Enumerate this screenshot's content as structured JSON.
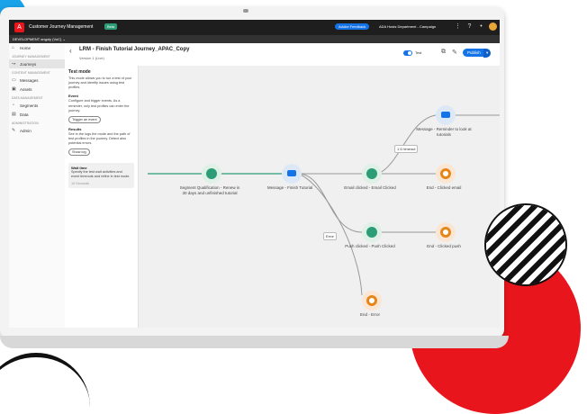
{
  "colors": {
    "accent": "#1473e6",
    "brand": "#e8151c",
    "start_node": "#2d9d78",
    "message_node": "#1473e6",
    "end_node": "#e68619"
  },
  "topbar": {
    "logo_glyph": "A",
    "app_name": "Customer Journey Management",
    "beta_badge": "Beta",
    "feedback_button": "Adobe Feedback",
    "org_name": "ADA Hosts Department - Campaign",
    "icons": [
      "apps-icon",
      "help-icon",
      "bell-icon",
      "settings-icon"
    ]
  },
  "sandbox": {
    "label": "DEVELOPMENT  angoly (VoC) ⌄"
  },
  "sidebar": {
    "home": "Home",
    "sec_journey": "JOURNEY MANAGEMENT",
    "journeys": "Journeys",
    "sec_content": "CONTENT MANAGEMENT",
    "messages": "Messages",
    "assets": "Assets",
    "sec_data": "DATA MANAGEMENT",
    "segments": "Segments",
    "data": "Data",
    "sec_admin": "ADMINISTRATION",
    "admin": "Admin"
  },
  "header": {
    "title": "LRM - Finish Tutorial Journey_APAC_Copy",
    "version": "Version 1 (Live)",
    "test_label": "Test",
    "publish": "Publish"
  },
  "test_panel": {
    "title": "Test mode",
    "desc": "This mode allows you to run a test of your journey and identify issues using test profiles.",
    "event_heading": "Event",
    "event_desc": "Configure and trigger events. As a reminder, only test profiles can enter the journey.",
    "trigger_button": "Trigger an event",
    "results_heading": "Results",
    "results_desc": "See in the logs the mode and the path of test profiles in the journey. Detect also potential errors.",
    "show_log_button": "Show log",
    "wait_title": "Wait time",
    "wait_desc": "Specify the test wait activities and event timeouts and refine in test mode.",
    "wait_value": "10",
    "wait_unit": "Seconds"
  },
  "journey": {
    "start_label": "Segment Qualification - Renew in 30 days and unfinished tutorial",
    "message1_label": "Message - Finish Tutorial",
    "email_label": "Email clicked - Email Clicked",
    "reminder_label": "Message - Reminder to look at tutorials",
    "end_email_label": "End - Clicked email",
    "push_label": "Push clicked - Push Clicked",
    "end_push_label": "End - Clicked push",
    "end_error_label": "End - Error",
    "edge_timeout": "1 D timeout",
    "edge_error": "Error"
  }
}
